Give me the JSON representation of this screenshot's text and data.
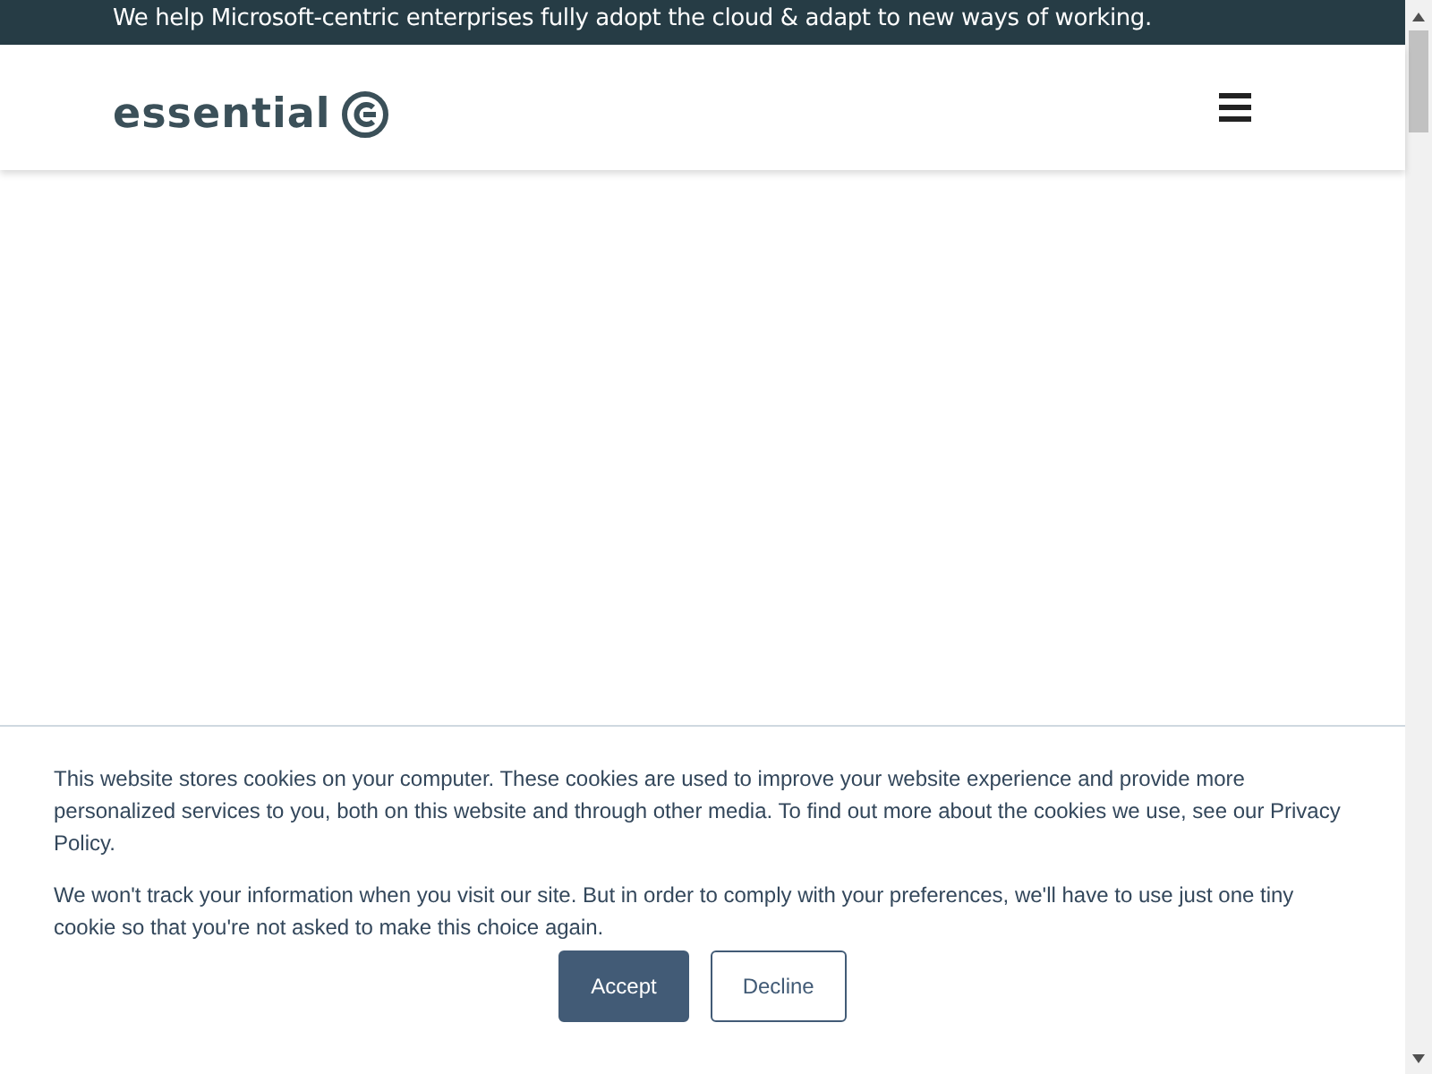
{
  "top_bar": {
    "text": "We help Microsoft-centric enterprises fully adopt the cloud & adapt to new ways of working."
  },
  "header": {
    "logo_text": "essential"
  },
  "cookie_banner": {
    "paragraphs": [
      "This website stores cookies on your computer. These cookies are used to improve your website experience and provide more personalized services to you, both on this website and through other media. To find out more about the cookies we use, see our Privacy Policy.",
      "We won't track your information when you visit our site. But in order to comply with your preferences, we'll have to use just one tiny cookie so that you're not asked to make this choice again."
    ],
    "buttons": [
      {
        "label": "Accept",
        "kind": "primary"
      },
      {
        "label": "Decline",
        "kind": "secondary"
      }
    ]
  }
}
